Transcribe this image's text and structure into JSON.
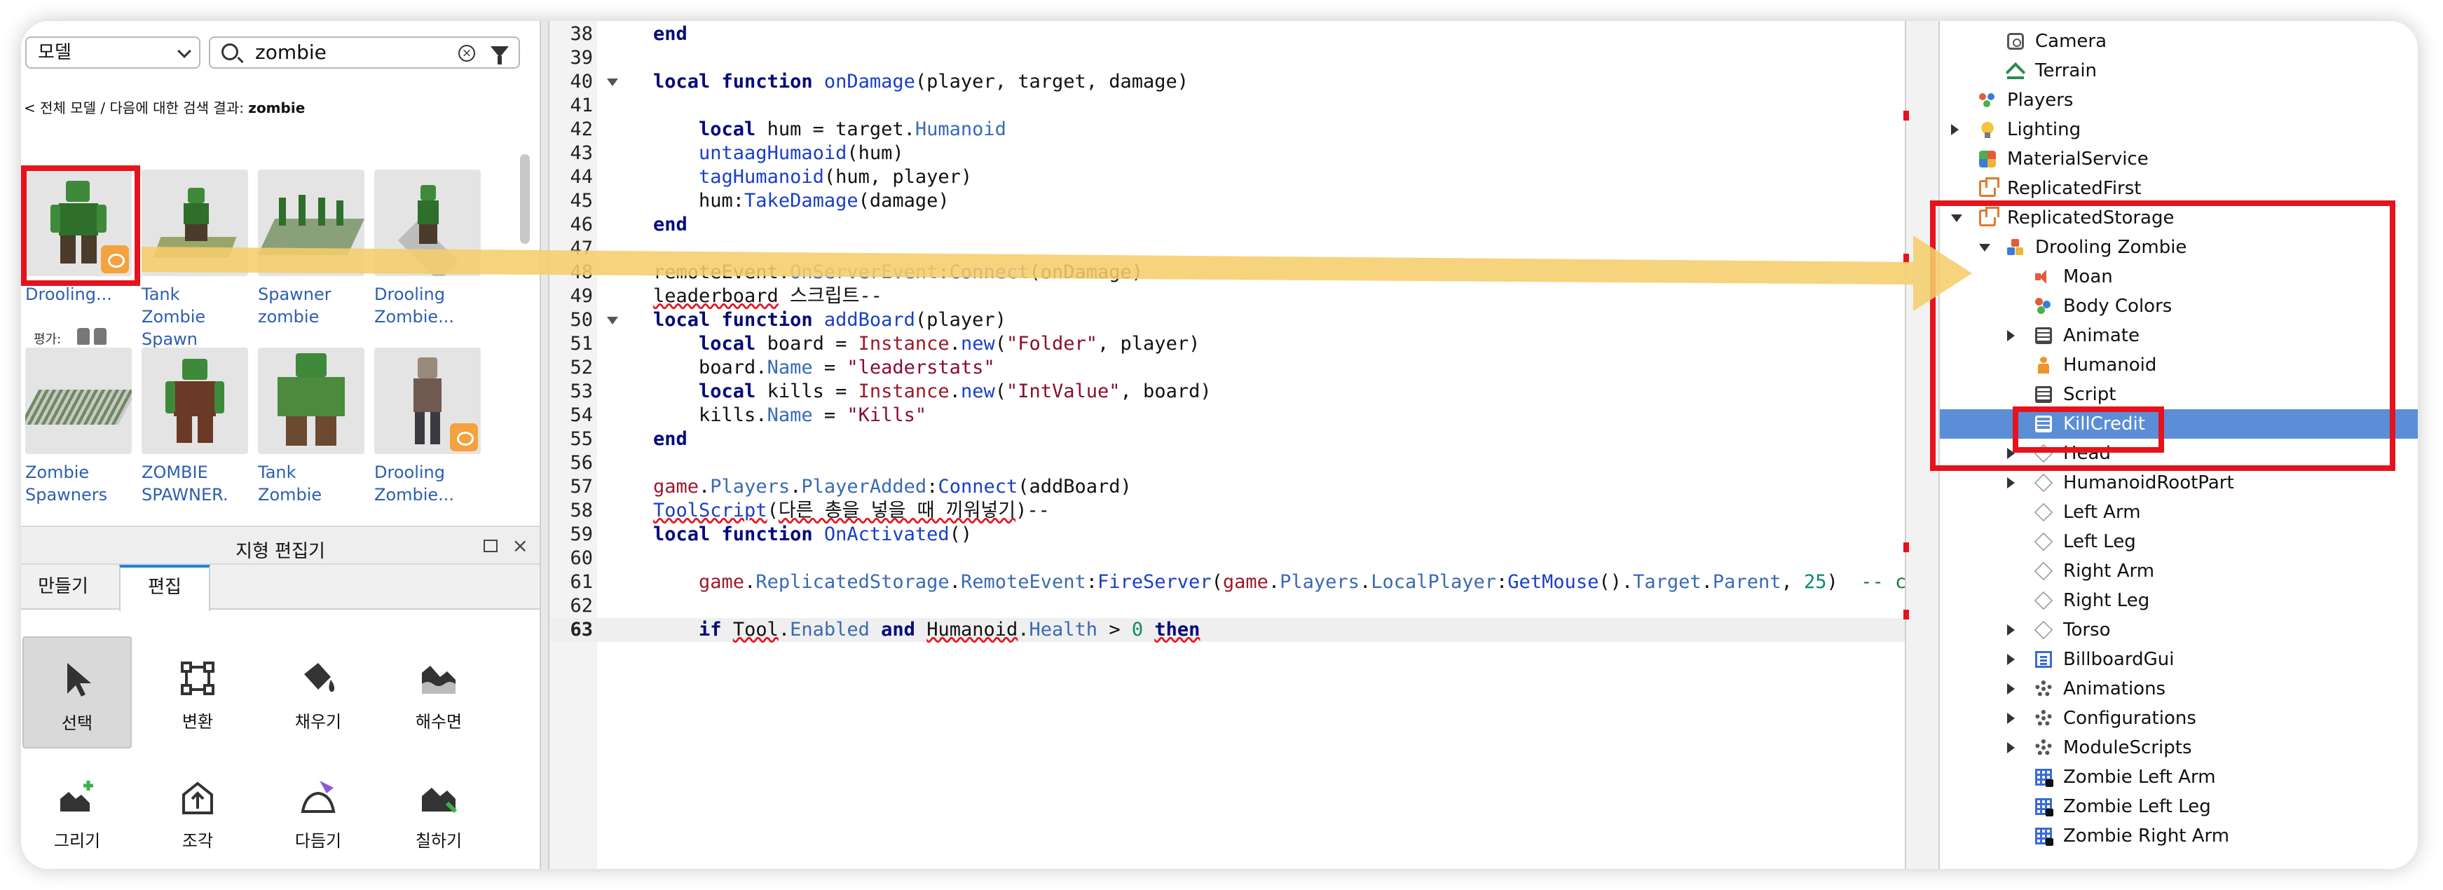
{
  "toolbox": {
    "category_select": "모델",
    "search_value": "zombie",
    "breadcrumb_prefix": "< 전체 모델 / 다음에 대한 검색 결과: ",
    "breadcrumb_query": "zombie",
    "rating_label": "평가:",
    "items": [
      {
        "name": "Drooling..."
      },
      {
        "name": "Tank Zombie Spawn"
      },
      {
        "name": "Spawner zombie"
      },
      {
        "name": "Drooling Zombie..."
      },
      {
        "name": "Zombie Spawners"
      },
      {
        "name": "ZOMBIE SPAWNER."
      },
      {
        "name": "Tank Zombie"
      },
      {
        "name": "Drooling Zombie..."
      }
    ]
  },
  "terrain_editor": {
    "title": "지형 편집기",
    "tabs": [
      "만들기",
      "편집"
    ],
    "active_tab": "편집",
    "tools": [
      {
        "label": "선택",
        "icon": "cursor-icon",
        "selected": true
      },
      {
        "label": "변환",
        "icon": "transform-icon",
        "selected": false
      },
      {
        "label": "채우기",
        "icon": "fill-bucket-icon",
        "selected": false
      },
      {
        "label": "해수면",
        "icon": "sea-level-icon",
        "selected": false
      },
      {
        "label": "그리기",
        "icon": "draw-icon",
        "selected": false
      },
      {
        "label": "조각",
        "icon": "sculpt-icon",
        "selected": false
      },
      {
        "label": "다듬기",
        "icon": "smooth-icon",
        "selected": false
      },
      {
        "label": "칠하기",
        "icon": "paint-icon",
        "selected": false
      }
    ]
  },
  "editor": {
    "current_line": 63,
    "lines": [
      {
        "n": "38",
        "fold": false,
        "html": "<span class='kw'>end</span>"
      },
      {
        "n": "39",
        "fold": false,
        "html": ""
      },
      {
        "n": "40",
        "fold": true,
        "html": "<span class='kw'>local</span> <span class='kw'>function</span> <span class='fn'>onDamage</span>(player, target, damage)"
      },
      {
        "n": "41",
        "fold": false,
        "html": ""
      },
      {
        "n": "42",
        "fold": false,
        "html": "    <span class='kw'>local</span> hum = target.<span class='prop'>Humanoid</span>"
      },
      {
        "n": "43",
        "fold": false,
        "html": "    <span class='fn'>untaagHumaoid</span>(hum)"
      },
      {
        "n": "44",
        "fold": false,
        "html": "    <span class='fn'>tagHumanoid</span>(hum, player)"
      },
      {
        "n": "45",
        "fold": false,
        "html": "    hum:<span class='fn'>TakeDamage</span>(damage)"
      },
      {
        "n": "46",
        "fold": false,
        "html": "<span class='kw'>end</span>"
      },
      {
        "n": "47",
        "fold": false,
        "html": ""
      },
      {
        "n": "48",
        "fold": false,
        "html": "remoteEvent.<span class='prop'>OnServerEvent</span>:<span class='fn'>Connect</span>(onDamage)"
      },
      {
        "n": "49",
        "fold": false,
        "html": "<span class='ul'>leaderboard</span> 스크립트--"
      },
      {
        "n": "50",
        "fold": true,
        "html": "<span class='kw'>local</span> <span class='kw'>function</span> <span class='fn'>addBoard</span>(player)"
      },
      {
        "n": "51",
        "fold": false,
        "html": "    <span class='kw'>local</span> board = <span class='glob'>Instance</span>.<span class='fn'>new</span>(<span class='str'>\"Folder\"</span>, player)"
      },
      {
        "n": "52",
        "fold": false,
        "html": "    board.<span class='prop'>Name</span> = <span class='str'>\"leaderstats\"</span>"
      },
      {
        "n": "53",
        "fold": false,
        "html": "    <span class='kw'>local</span> kills = <span class='glob'>Instance</span>.<span class='fn'>new</span>(<span class='str'>\"IntValue\"</span>, board)"
      },
      {
        "n": "54",
        "fold": false,
        "html": "    kills.<span class='prop'>Name</span> = <span class='str'>\"Kills\"</span>"
      },
      {
        "n": "55",
        "fold": false,
        "html": "<span class='kw'>end</span>"
      },
      {
        "n": "56",
        "fold": false,
        "html": ""
      },
      {
        "n": "57",
        "fold": false,
        "html": "<span class='glob'>game</span>.<span class='prop'>Players</span>.<span class='prop'>PlayerAdded</span>:<span class='fn'>Connect</span>(addBoard)"
      },
      {
        "n": "58",
        "fold": false,
        "html": "<span class='fn ul'>ToolScript</span>(<span class='ul'>다른 총을 넣을 때 끼워넣기</span>)--"
      },
      {
        "n": "59",
        "fold": false,
        "html": "<span class='kw'>local</span> <span class='kw'>function</span> <span class='fn'>OnActivated</span>()"
      },
      {
        "n": "60",
        "fold": false,
        "html": ""
      },
      {
        "n": "61",
        "fold": false,
        "html": "    <span class='glob'>game</span>.<span class='prop'>ReplicatedStorage</span>.<span class='prop'>RemoteEvent</span>:<span class='fn'>FireServer</span>(<span class='glob'>game</span>.<span class='prop'>Players</span>.<span class='prop'>LocalPlayer</span>:<span class='fn'>GetMouse</span>().<span class='prop'>Target</span>.<span class='prop'>Parent</span>, <span class='num'>25</span>)  <span class='cmt'>-- c</span>"
      },
      {
        "n": "62",
        "fold": false,
        "html": ""
      },
      {
        "n": "63",
        "fold": false,
        "html": "    <span class='kw'>if</span> <span class='ul'>Tool</span>.<span class='prop'>Enabled</span> <span class='kw'>and</span> <span class='ul'>Humanoid</span>.<span class='prop'>Health</span> &gt; <span class='num'>0</span> <span class='kw ul'>then</span>"
      }
    ]
  },
  "explorer": {
    "rows": [
      {
        "label": "Camera",
        "icon": "camera-icon",
        "indent": 1,
        "arrow": "",
        "selected": false
      },
      {
        "label": "Terrain",
        "icon": "terrain-icon",
        "indent": 1,
        "arrow": "",
        "selected": false
      },
      {
        "label": "Players",
        "icon": "players-icon",
        "indent": 0,
        "arrow": "",
        "selected": false
      },
      {
        "label": "Lighting",
        "icon": "lighting-icon",
        "indent": 0,
        "arrow": "right",
        "selected": false
      },
      {
        "label": "MaterialService",
        "icon": "material-service-icon",
        "indent": 0,
        "arrow": "",
        "selected": false
      },
      {
        "label": "ReplicatedFirst",
        "icon": "replicated-first-icon",
        "indent": 0,
        "arrow": "",
        "selected": false
      },
      {
        "label": "ReplicatedStorage",
        "icon": "replicated-storage-icon",
        "indent": 0,
        "arrow": "down",
        "selected": false
      },
      {
        "label": "Drooling Zombie",
        "icon": "model-icon",
        "indent": 1,
        "arrow": "down",
        "selected": false
      },
      {
        "label": "Moan",
        "icon": "sound-icon",
        "indent": 2,
        "arrow": "",
        "selected": false
      },
      {
        "label": "Body Colors",
        "icon": "body-colors-icon",
        "indent": 2,
        "arrow": "",
        "selected": false
      },
      {
        "label": "Animate",
        "icon": "script-icon",
        "indent": 2,
        "arrow": "right",
        "selected": false
      },
      {
        "label": "Humanoid",
        "icon": "humanoid-icon",
        "indent": 2,
        "arrow": "",
        "selected": false
      },
      {
        "label": "Script",
        "icon": "script-icon",
        "indent": 2,
        "arrow": "",
        "selected": false
      },
      {
        "label": "KillCredit",
        "icon": "script-icon",
        "indent": 2,
        "arrow": "",
        "selected": true
      },
      {
        "label": "Head",
        "icon": "part-icon",
        "indent": 2,
        "arrow": "right",
        "selected": false
      },
      {
        "label": "HumanoidRootPart",
        "icon": "part-icon",
        "indent": 2,
        "arrow": "right",
        "selected": false
      },
      {
        "label": "Left Arm",
        "icon": "part-icon",
        "indent": 2,
        "arrow": "",
        "selected": false
      },
      {
        "label": "Left Leg",
        "icon": "part-icon",
        "indent": 2,
        "arrow": "",
        "selected": false
      },
      {
        "label": "Right Arm",
        "icon": "part-icon",
        "indent": 2,
        "arrow": "",
        "selected": false
      },
      {
        "label": "Right Leg",
        "icon": "part-icon",
        "indent": 2,
        "arrow": "",
        "selected": false
      },
      {
        "label": "Torso",
        "icon": "part-icon",
        "indent": 2,
        "arrow": "right",
        "selected": false
      },
      {
        "label": "BillboardGui",
        "icon": "billboard-gui-icon",
        "indent": 2,
        "arrow": "right",
        "selected": false
      },
      {
        "label": "Animations",
        "icon": "gear-icon",
        "indent": 2,
        "arrow": "right",
        "selected": false
      },
      {
        "label": "Configurations",
        "icon": "gear-icon",
        "indent": 2,
        "arrow": "right",
        "selected": false
      },
      {
        "label": "ModuleScripts",
        "icon": "gear-icon",
        "indent": 2,
        "arrow": "right",
        "selected": false
      },
      {
        "label": "Zombie Left Arm",
        "icon": "weld-icon",
        "indent": 2,
        "arrow": "",
        "selected": false
      },
      {
        "label": "Zombie Left Leg",
        "icon": "weld-icon",
        "indent": 2,
        "arrow": "",
        "selected": false
      },
      {
        "label": "Zombie Right Arm",
        "icon": "weld-icon",
        "indent": 2,
        "arrow": "",
        "selected": false
      }
    ]
  },
  "colors": {
    "annotation_red": "#e6131d",
    "arrow_yellow": "#f5cd6b",
    "selection_blue": "#5b8ed6",
    "tab_accent": "#1f86d8"
  }
}
